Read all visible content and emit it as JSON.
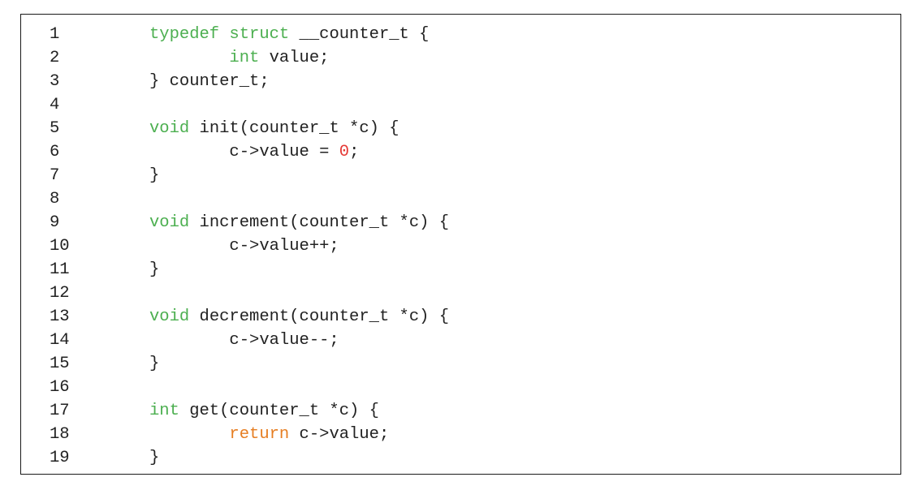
{
  "code": {
    "lines": [
      {
        "num": "1",
        "tokens": [
          {
            "t": "typedef struct",
            "k": "type"
          },
          {
            "t": " __counter_t {",
            "k": "plain"
          }
        ]
      },
      {
        "num": "2",
        "tokens": [
          {
            "t": "        ",
            "k": "plain"
          },
          {
            "t": "int",
            "k": "type"
          },
          {
            "t": " value;",
            "k": "plain"
          }
        ]
      },
      {
        "num": "3",
        "tokens": [
          {
            "t": "} counter_t;",
            "k": "plain"
          }
        ]
      },
      {
        "num": "4",
        "tokens": []
      },
      {
        "num": "5",
        "tokens": [
          {
            "t": "void",
            "k": "type"
          },
          {
            "t": " init(counter_t *c) {",
            "k": "plain"
          }
        ]
      },
      {
        "num": "6",
        "tokens": [
          {
            "t": "        c->value = ",
            "k": "plain"
          },
          {
            "t": "0",
            "k": "number"
          },
          {
            "t": ";",
            "k": "plain"
          }
        ]
      },
      {
        "num": "7",
        "tokens": [
          {
            "t": "}",
            "k": "plain"
          }
        ]
      },
      {
        "num": "8",
        "tokens": []
      },
      {
        "num": "9",
        "tokens": [
          {
            "t": "void",
            "k": "type"
          },
          {
            "t": " increment(counter_t *c) {",
            "k": "plain"
          }
        ]
      },
      {
        "num": "10",
        "tokens": [
          {
            "t": "        c->value++;",
            "k": "plain"
          }
        ]
      },
      {
        "num": "11",
        "tokens": [
          {
            "t": "}",
            "k": "plain"
          }
        ]
      },
      {
        "num": "12",
        "tokens": []
      },
      {
        "num": "13",
        "tokens": [
          {
            "t": "void",
            "k": "type"
          },
          {
            "t": " decrement(counter_t *c) {",
            "k": "plain"
          }
        ]
      },
      {
        "num": "14",
        "tokens": [
          {
            "t": "        c->value--;",
            "k": "plain"
          }
        ]
      },
      {
        "num": "15",
        "tokens": [
          {
            "t": "}",
            "k": "plain"
          }
        ]
      },
      {
        "num": "16",
        "tokens": []
      },
      {
        "num": "17",
        "tokens": [
          {
            "t": "int",
            "k": "type"
          },
          {
            "t": " get(counter_t *c) {",
            "k": "plain"
          }
        ]
      },
      {
        "num": "18",
        "tokens": [
          {
            "t": "        ",
            "k": "plain"
          },
          {
            "t": "return",
            "k": "return"
          },
          {
            "t": " c->value;",
            "k": "plain"
          }
        ]
      },
      {
        "num": "19",
        "tokens": [
          {
            "t": "}",
            "k": "plain"
          }
        ]
      }
    ]
  },
  "colors": {
    "type_keyword": "#4caf50",
    "return_keyword": "#e67e22",
    "number_literal": "#e53935",
    "text": "#222222",
    "border": "#1a1a1a",
    "background": "#ffffff"
  }
}
